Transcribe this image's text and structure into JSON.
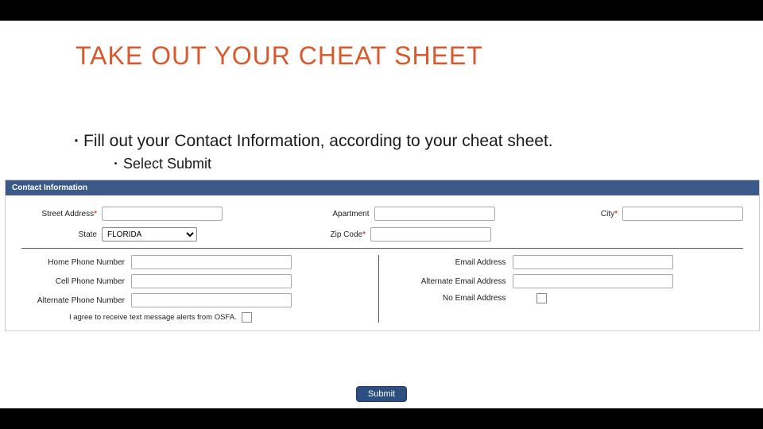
{
  "title": "TAKE OUT YOUR CHEAT SHEET",
  "bul1": "Fill out your Contact Information, according to your cheat sheet.",
  "bul2": "Select Submit",
  "panel": {
    "header": "Contact Information",
    "street_lbl": "Street Address",
    "apt_lbl": "Apartment",
    "city_lbl": "City",
    "state_lbl": "State",
    "state_val": "FLORIDA",
    "zip_lbl": "Zip Code",
    "home_lbl": "Home Phone Number",
    "cell_lbl": "Cell Phone Number",
    "alt_phone_lbl": "Alternate Phone Number",
    "consent": "I agree to receive text message alerts from OSFA.",
    "email_lbl": "Email Address",
    "alt_email_lbl": "Alternate Email Address",
    "no_email_lbl": "No Email Address",
    "submit": "Submit"
  }
}
